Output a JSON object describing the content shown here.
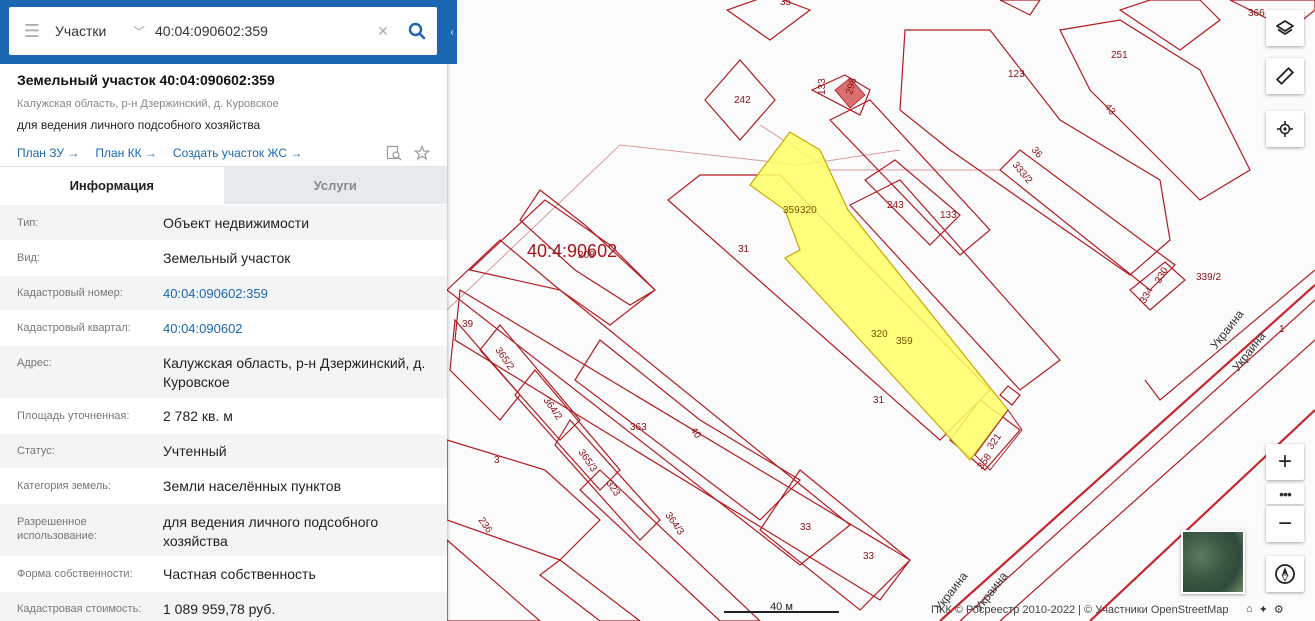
{
  "search": {
    "type_label": "Участки",
    "query": "40:04:090602:359"
  },
  "object": {
    "title": "Земельный участок 40:04:090602:359",
    "address": "Калужская область, р-н Дзержинский, д. Куровское",
    "purpose": "для ведения личного подсобного хозяйства",
    "links": [
      "План ЗУ →",
      "План КК →",
      "Создать участок ЖС →"
    ]
  },
  "tabs": [
    "Информация",
    "Услуги"
  ],
  "info": [
    {
      "key": "Тип:",
      "value": "Объект недвижимости"
    },
    {
      "key": "Вид:",
      "value": "Земельный участок"
    },
    {
      "key": "Кадастровый номер:",
      "value": "40:04:090602:359"
    },
    {
      "key": "Кадастровый квартал:",
      "value": "40:04:090602"
    },
    {
      "key": "Адрес:",
      "value": "Калужская область, р-н Дзержинский, д. Куровское"
    },
    {
      "key": "Площадь уточненная:",
      "value": "2 782 кв. м"
    },
    {
      "key": "Статус:",
      "value": "Учтенный"
    },
    {
      "key": "Категория земель:",
      "value": "Земли населённых пунктов"
    },
    {
      "key": "Разрешенное использование:",
      "value": "для ведения личного подсобного хозяйства"
    },
    {
      "key": "Форма собственности:",
      "value": "Частная собственность"
    },
    {
      "key": "Кадастровая стоимость:",
      "value": "1 089 959,78 руб."
    }
  ],
  "map": {
    "quarter_label": "40:4:90602",
    "scale_label": "40 м",
    "attribution": "ПКК © Росреестр 2010-2022 | © Участники OpenStreetMap",
    "street_name": "Украина",
    "parcel_labels": [
      "35",
      "242",
      "133",
      "298",
      "123",
      "251",
      "43",
      "36",
      "333/2",
      "243",
      "133",
      "31",
      "320",
      "359",
      "359",
      "320",
      "339/2",
      "330",
      "334",
      "1",
      "208",
      "39",
      "365/2",
      "364/2",
      "363",
      "40",
      "31",
      "365/3",
      "323",
      "3",
      "364/3",
      "33",
      "33",
      "236",
      "358",
      "321",
      "366"
    ],
    "highlight_color": "#ffff66",
    "boundary_color": "#b01c22"
  },
  "controls": {
    "layers_icon": "layers-icon",
    "ruler_icon": "ruler-icon",
    "locate_icon": "crosshair-icon",
    "zoom_in": "+",
    "zoom_more": "•••",
    "zoom_out": "−",
    "compass_icon": "compass-icon"
  },
  "colors": {
    "brand": "#1b67b1",
    "tab_inactive": "#e6e9ed"
  }
}
